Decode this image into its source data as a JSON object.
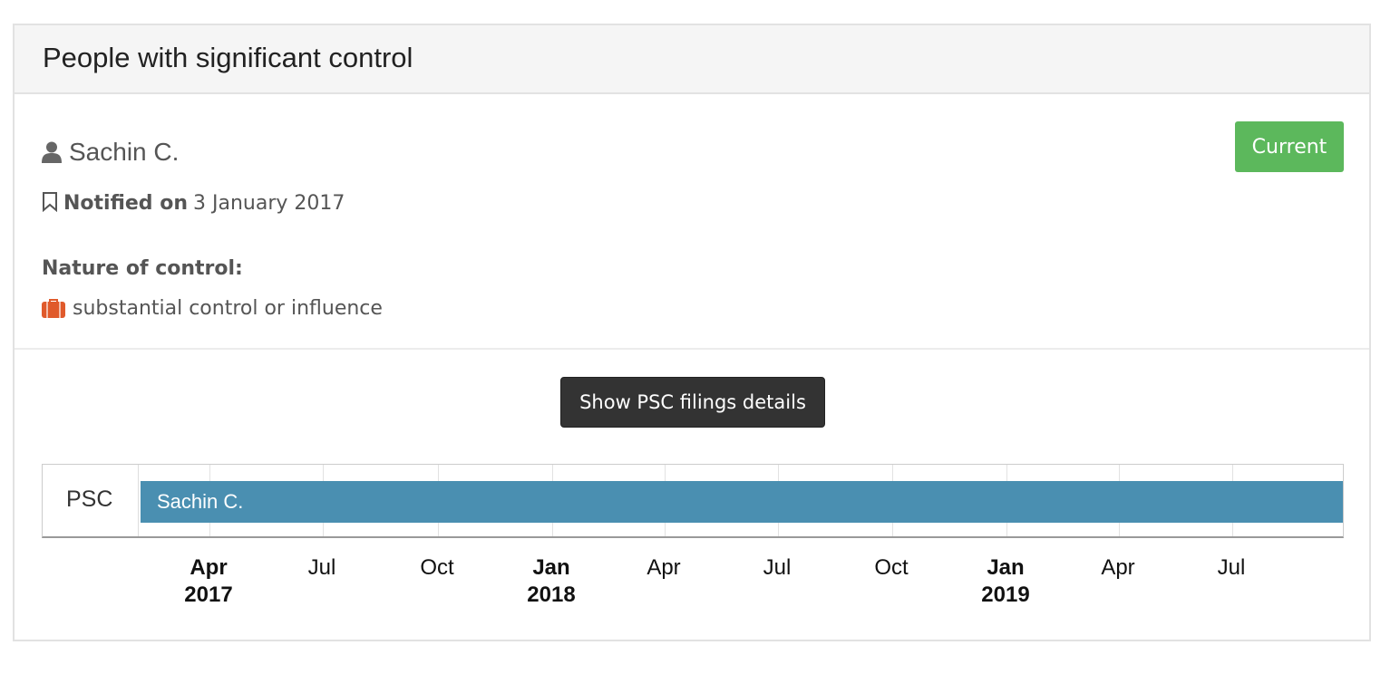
{
  "panel": {
    "title": "People with significant control"
  },
  "psc": {
    "name": "Sachin C.",
    "status": "Current",
    "notified_label": "Notified on",
    "notified_date": "3 January 2017",
    "nature_label": "Nature of control:",
    "nature_value": "substantial control or influence"
  },
  "icons": {
    "person": "user-icon",
    "bookmark": "bookmark-icon",
    "briefcase": "briefcase-icon"
  },
  "colors": {
    "status_badge": "#5cb85c",
    "timeline_bar": "#4a8fb1",
    "briefcase": "#e05a2b",
    "button_bg": "#333333"
  },
  "actions": {
    "show_filings": "Show PSC filings details"
  },
  "timeline": {
    "row_label": "PSC",
    "bar_label": "Sachin C.",
    "bar_start": "2017-01-03",
    "ticks": [
      {
        "month": "Apr",
        "year": "2017",
        "major": true
      },
      {
        "month": "Jul",
        "year": "",
        "major": false
      },
      {
        "month": "Oct",
        "year": "",
        "major": false
      },
      {
        "month": "Jan",
        "year": "2018",
        "major": true
      },
      {
        "month": "Apr",
        "year": "",
        "major": false
      },
      {
        "month": "Jul",
        "year": "",
        "major": false
      },
      {
        "month": "Oct",
        "year": "",
        "major": false
      },
      {
        "month": "Jan",
        "year": "2019",
        "major": true
      },
      {
        "month": "Apr",
        "year": "",
        "major": false
      },
      {
        "month": "Jul",
        "year": "",
        "major": false
      }
    ]
  }
}
